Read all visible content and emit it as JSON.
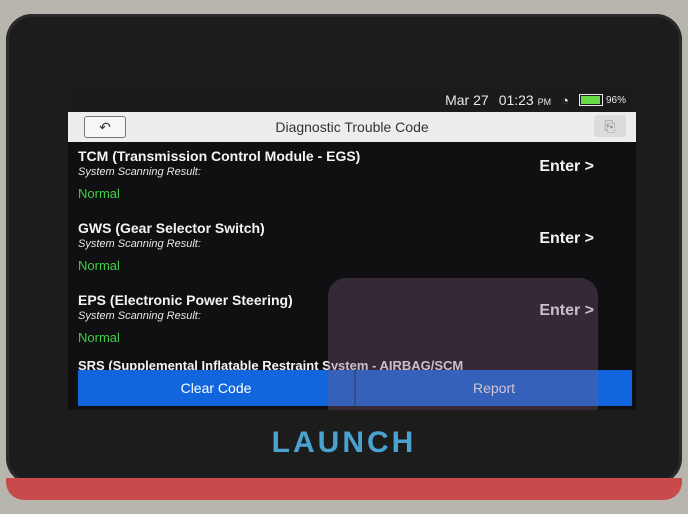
{
  "status": {
    "date": "Mar 27",
    "time": "01:23",
    "ampm": "PM",
    "battery": "96%",
    "battery_level": 0.96
  },
  "header": {
    "title": "Diagnostic Trouble Code"
  },
  "items": [
    {
      "name": "TCM (Transmission Control Module - EGS)",
      "result_label": "System Scanning Result:",
      "status": "Normal",
      "enter": "Enter >"
    },
    {
      "name": "GWS (Gear Selector Switch)",
      "result_label": "System Scanning Result:",
      "status": "Normal",
      "enter": "Enter >"
    },
    {
      "name": "EPS (Electronic Power Steering)",
      "result_label": "System Scanning Result:",
      "status": "Normal",
      "enter": "Enter >"
    }
  ],
  "partial_item": {
    "name": "SRS (Supplemental Inflatable Restraint System - AIRBAG/SCM"
  },
  "actions": {
    "clear": "Clear Code",
    "report": "Report"
  },
  "device": {
    "brand": "LAUNCH"
  },
  "colors": {
    "accent_blue": "#1166dd",
    "normal_green": "#3fce4a",
    "logo_blue": "#4aa3cf"
  }
}
